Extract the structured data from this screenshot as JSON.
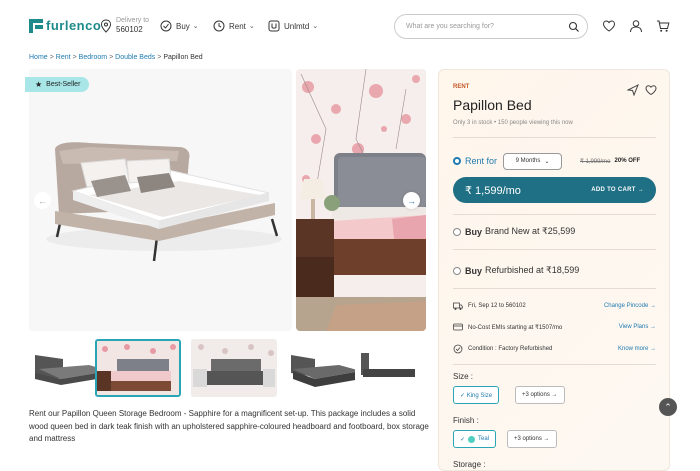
{
  "header": {
    "logo": "furlenco",
    "delivery_label": "Delivery to",
    "delivery_pincode": "560102",
    "nav": [
      {
        "label": "Buy",
        "icon": "buy-icon"
      },
      {
        "label": "Rent",
        "icon": "rent-clock-icon"
      },
      {
        "label": "Unlmtd",
        "icon": "unlmtd-icon"
      }
    ],
    "search_placeholder": "What are you searching for?",
    "icons": [
      "heart-icon",
      "user-icon",
      "cart-icon"
    ]
  },
  "breadcrumb": {
    "items": [
      "Home",
      "Rent",
      "Bedroom",
      "Double Beds"
    ],
    "separator": ">",
    "current": "Papillon Bed"
  },
  "gallery": {
    "badge": "Best-Seller",
    "thumbnails_count": 5,
    "selected_thumbnail": 2
  },
  "description": "Rent our Papillon Queen Storage Bedroom - Sapphire for a magnificent set-up. This package includes a solid wood queen bed in dark teak finish with an upholstered sapphire-coloured headboard and footboard, box storage and mattress",
  "product": {
    "tag": "RENT",
    "title": "Papillon Bed",
    "stock_note": "Only 3 in stock  •  150 people viewing this now",
    "rent_label": "Rent for",
    "months": "9 Months",
    "old_price": "₹ 1,999/mo",
    "discount": "20% OFF",
    "price": "₹ 1,599/mo",
    "add_to_cart": "ADD TO CART →",
    "buy_new_label": "Buy",
    "buy_new_text": "Brand New at ₹25,599",
    "buy_ref_label": "Buy",
    "buy_ref_text": "Refurbished at ₹18,599",
    "info": [
      {
        "text": "Fri, Sep 12 to 560102",
        "link": "Change Pincode →",
        "icon": "truck-icon"
      },
      {
        "text": "No-Cost EMIs starting at ₹1507/mo",
        "link": "View Plans →",
        "icon": "emi-icon"
      },
      {
        "text": "Condition : Factory Refurbished",
        "link": "Know more →",
        "icon": "badge-icon"
      }
    ],
    "size_label": "Size :",
    "size_selected": "✓ King Size",
    "size_more": "+3 options →",
    "finish_label": "Finish :",
    "finish_selected": "Teal",
    "finish_check": "✓",
    "finish_more": "+3 options →",
    "storage_label": "Storage :"
  },
  "colors": {
    "brand": "#1f8a8a",
    "cta": "#1f6f85",
    "link": "#1f7ab0",
    "badge": "#a8e6e7"
  }
}
